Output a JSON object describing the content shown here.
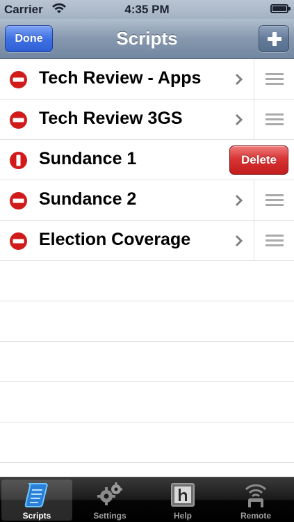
{
  "status_bar": {
    "carrier": "Carrier",
    "time": "4:35 PM"
  },
  "nav": {
    "title": "Scripts",
    "done_label": "Done"
  },
  "scripts": [
    {
      "title": "Tech Review - Apps"
    },
    {
      "title": "Tech Review 3GS"
    },
    {
      "title": "Sundance 1",
      "delete_label": "Delete"
    },
    {
      "title": "Sundance 2"
    },
    {
      "title": "Election Coverage"
    }
  ],
  "tabs": [
    {
      "label": "Scripts",
      "icon": "scroll-icon",
      "selected": true
    },
    {
      "label": "Settings",
      "icon": "gears-icon",
      "selected": false
    },
    {
      "label": "Help",
      "icon": "help-h-icon",
      "selected": false
    },
    {
      "label": "Remote",
      "icon": "remote-icon",
      "selected": false
    }
  ],
  "colors": {
    "accent_blue": "#3f71e4",
    "delete_red": "#d83535",
    "nav_gradient": "#8698ae"
  }
}
